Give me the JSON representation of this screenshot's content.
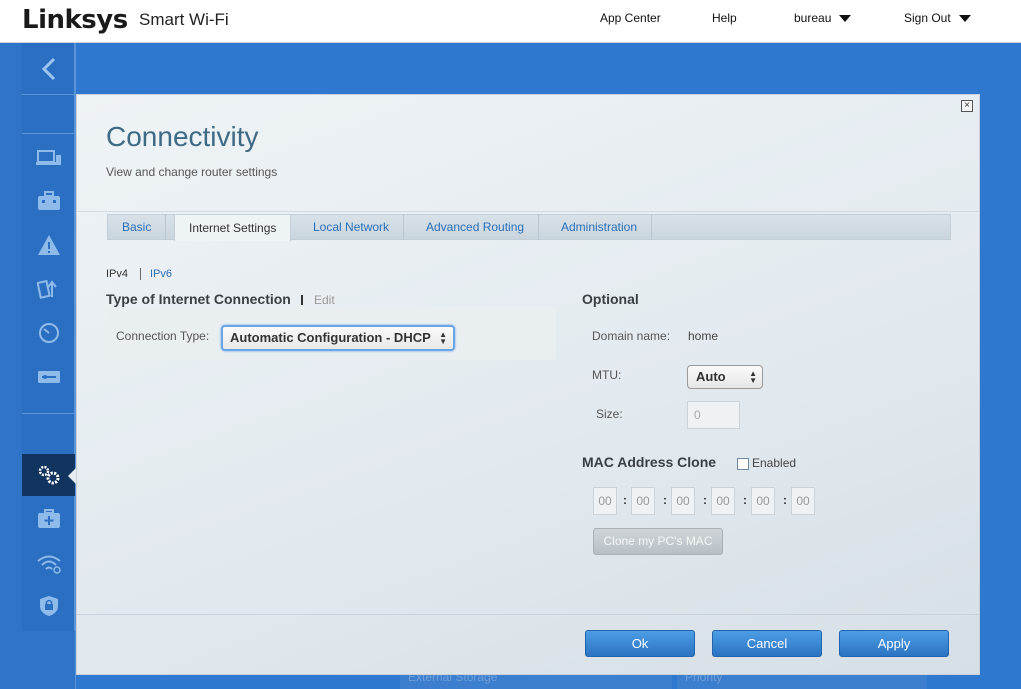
{
  "header": {
    "logo": "Linksys",
    "product": "Smart Wi-Fi",
    "nav": {
      "app_center": "App Center",
      "help": "Help",
      "user": "bureau",
      "sign_out": "Sign Out"
    }
  },
  "background": {
    "ghost_left": "External Storage",
    "ghost_right": "Priority"
  },
  "panel": {
    "title": "Connectivity",
    "subtitle": "View and change router settings",
    "close": "×",
    "tabs": [
      {
        "label": "Basic"
      },
      {
        "label": "Internet Settings"
      },
      {
        "label": "Local Network"
      },
      {
        "label": "Advanced Routing"
      },
      {
        "label": "Administration"
      }
    ],
    "ip_versions": {
      "ipv4": "IPv4",
      "ipv6": "IPv6"
    },
    "connection": {
      "heading": "Type of Internet Connection",
      "edit": "Edit",
      "type_label": "Connection Type:",
      "type_value": "Automatic Configuration - DHCP"
    },
    "optional": {
      "heading": "Optional",
      "domain_label": "Domain name:",
      "domain_value": "home",
      "mtu_label": "MTU:",
      "mtu_value": "Auto",
      "size_label": "Size:",
      "size_value": "0"
    },
    "mac_clone": {
      "heading": "MAC Address Clone",
      "enabled_label": "Enabled",
      "octets": [
        "00",
        "00",
        "00",
        "00",
        "00",
        "00"
      ],
      "clone_button": "Clone my PC's MAC"
    },
    "buttons": {
      "ok": "Ok",
      "cancel": "Cancel",
      "apply": "Apply"
    }
  },
  "colors": {
    "brand_blue": "#2f74c6",
    "sidebar_active": "#12355f",
    "button_blue": "#2a73c2",
    "title_color": "#3f6a85"
  }
}
